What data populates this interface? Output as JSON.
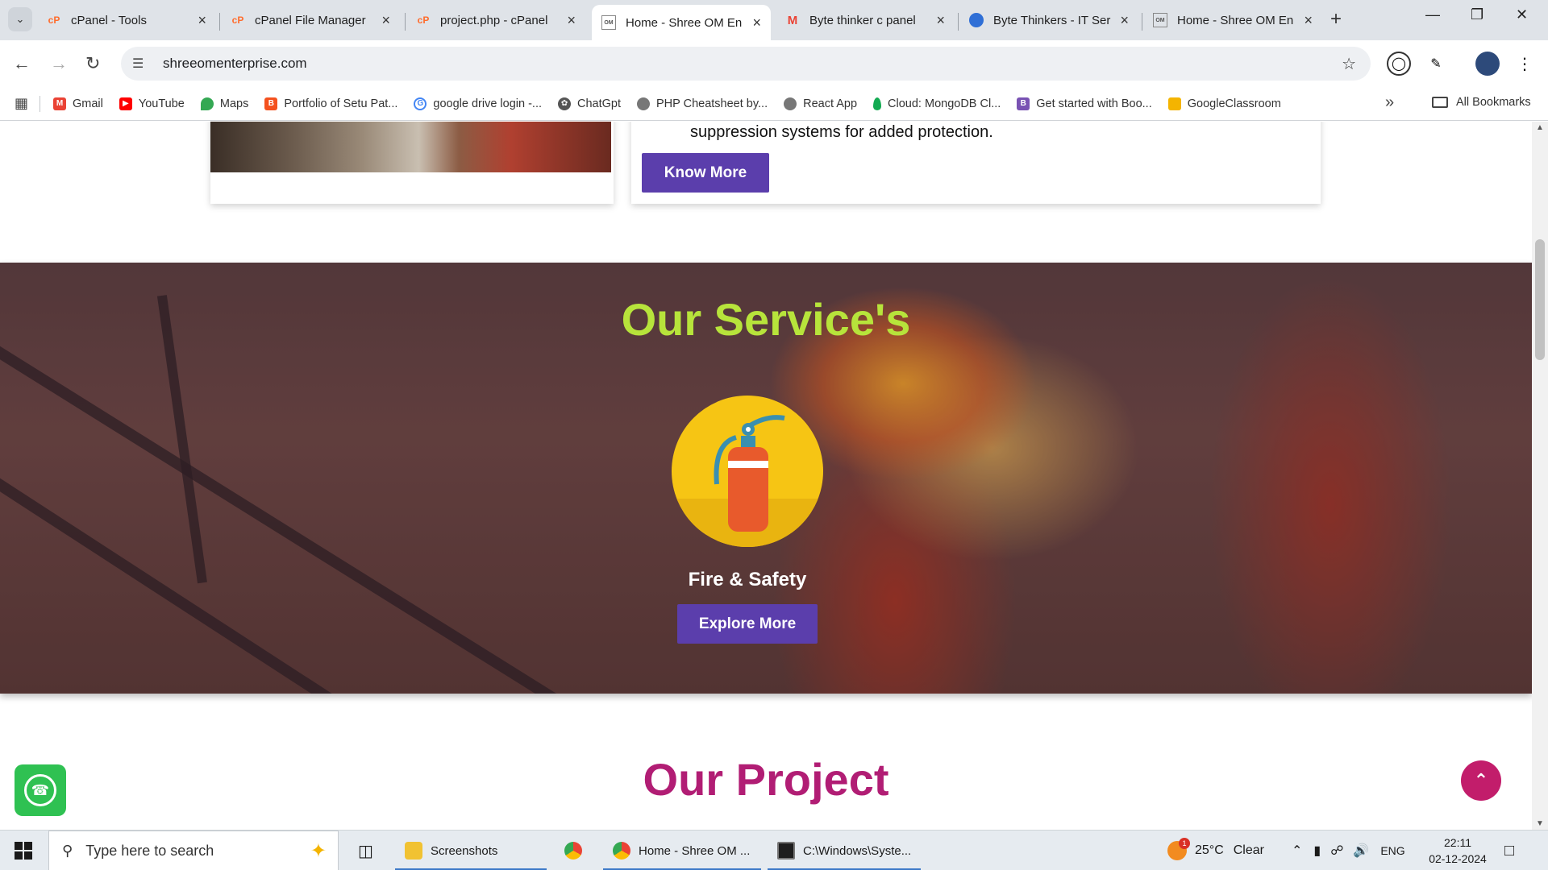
{
  "browser": {
    "tabs": [
      {
        "title": "cPanel - Tools",
        "favicon": "cpanel-icon",
        "active": false
      },
      {
        "title": "cPanel File Manager",
        "favicon": "cpanel-icon",
        "active": false
      },
      {
        "title": "project.php - cPanel",
        "favicon": "cpanel-icon",
        "active": false
      },
      {
        "title": "Home - Shree OM En",
        "favicon": "site-icon",
        "active": true
      },
      {
        "title": "Byte thinker c panel",
        "favicon": "gmail-icon",
        "active": false
      },
      {
        "title": "Byte Thinkers - IT Ser",
        "favicon": "globe-icon",
        "active": false
      },
      {
        "title": "Home - Shree OM En",
        "favicon": "site-icon",
        "active": false
      }
    ],
    "url": "shreeomenterprise.com",
    "bookmarks": [
      {
        "label": "Gmail",
        "icon": "gmail-icon",
        "color": "#ea4335"
      },
      {
        "label": "YouTube",
        "icon": "youtube-icon",
        "color": "#ff0000"
      },
      {
        "label": "Maps",
        "icon": "maps-icon",
        "color": "#34a853"
      },
      {
        "label": "Portfolio of Setu Pat...",
        "icon": "portfolio-icon",
        "color": "#f4511e"
      },
      {
        "label": "google drive login -...",
        "icon": "google-icon",
        "color": "#4285f4"
      },
      {
        "label": "ChatGpt",
        "icon": "chatgpt-icon",
        "color": "#555555"
      },
      {
        "label": "PHP Cheatsheet by...",
        "icon": "globe-icon",
        "color": "#777777"
      },
      {
        "label": "React App",
        "icon": "globe-icon",
        "color": "#777777"
      },
      {
        "label": "Cloud: MongoDB Cl...",
        "icon": "mongodb-icon",
        "color": "#13aa52"
      },
      {
        "label": "Get started with Boo...",
        "icon": "bootstrap-icon",
        "color": "#7952b3"
      },
      {
        "label": "GoogleClassroom",
        "icon": "classroom-icon",
        "color": "#f4b400"
      }
    ],
    "all_bookmarks": "All Bookmarks"
  },
  "page": {
    "card_text": "suppression systems for added protection.",
    "know_more": "Know More",
    "services_title": "Our Service's",
    "service_name": "Fire & Safety",
    "explore_more": "Explore More",
    "project_title": "Our Project",
    "colors": {
      "accent_green": "#b7e43b",
      "button_purple": "#5b3eac",
      "project_pink": "#b11d74"
    }
  },
  "taskbar": {
    "search_placeholder": "Type here to search",
    "apps": [
      {
        "label": "Screenshots",
        "icon": "folder-icon"
      },
      {
        "label": "",
        "icon": "chrome-icon"
      },
      {
        "label": "Home - Shree OM ...",
        "icon": "chrome-icon"
      },
      {
        "label": "C:\\Windows\\Syste...",
        "icon": "cmd-icon"
      }
    ],
    "weather": {
      "temp": "25°C",
      "condition": "Clear",
      "badge": "1"
    },
    "lang": "ENG",
    "time": "22:11",
    "date": "02-12-2024"
  }
}
